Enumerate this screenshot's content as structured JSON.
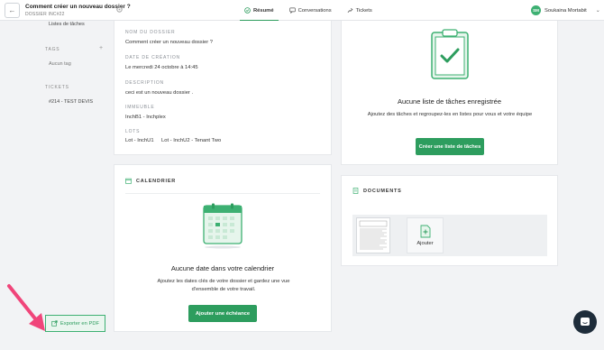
{
  "header": {
    "back_label": "←",
    "title": "Comment créer un nouveau dossier ?",
    "subtitle": "DOSSIER INC#22",
    "tabs": [
      {
        "label": "Résumé",
        "active": true
      },
      {
        "label": "Conversations",
        "active": false
      },
      {
        "label": "Tickets",
        "active": false
      }
    ],
    "user": {
      "initials": "SM",
      "name": "Soukaina Mortabit"
    }
  },
  "sidebar": {
    "link_task_lists": "Listes de tâches",
    "tags_heading": "TAGS",
    "tags_add": "+",
    "tags_empty": "Aucun tag",
    "tickets_heading": "TICKETS",
    "ticket_item": "#214 - TEST DEVIS",
    "export_label": "Exporter en PDF"
  },
  "details": {
    "name_label": "NOM DU DOSSIER",
    "name_value": "Comment créer un nouveau dossier ?",
    "date_label": "DATE DE CRÉATION",
    "date_value": "Le mercredi 24 octobre à 14:45",
    "desc_label": "DESCRIPTION",
    "desc_value": "ceci est un nouveau dossier .",
    "building_label": "IMMEUBLE",
    "building_value": "InchB1 - Inchplex",
    "lots_label": "LOTS",
    "lots": [
      "Lot - InchU1",
      "Lot - InchU2 - Tenant Two"
    ]
  },
  "tasks": {
    "empty_title": "Aucune liste de tâches enregistrée",
    "empty_desc": "Ajoutez des tâches et regroupez-les en listes pour vous et votre équipe",
    "button": "Créer une liste de tâches"
  },
  "calendar": {
    "heading": "CALENDRIER",
    "empty_title": "Aucune date dans votre calendrier",
    "empty_desc": "Ajoutez les dates clés de votre dossier et gardez une vue d'ensemble de votre travail.",
    "button": "Ajouter une échéance"
  },
  "documents": {
    "heading": "DOCUMENTS",
    "add_label": "Ajouter"
  },
  "colors": {
    "accent": "#2d9d5e",
    "accent_light": "#3db072",
    "annotation_arrow": "#f0457a"
  }
}
